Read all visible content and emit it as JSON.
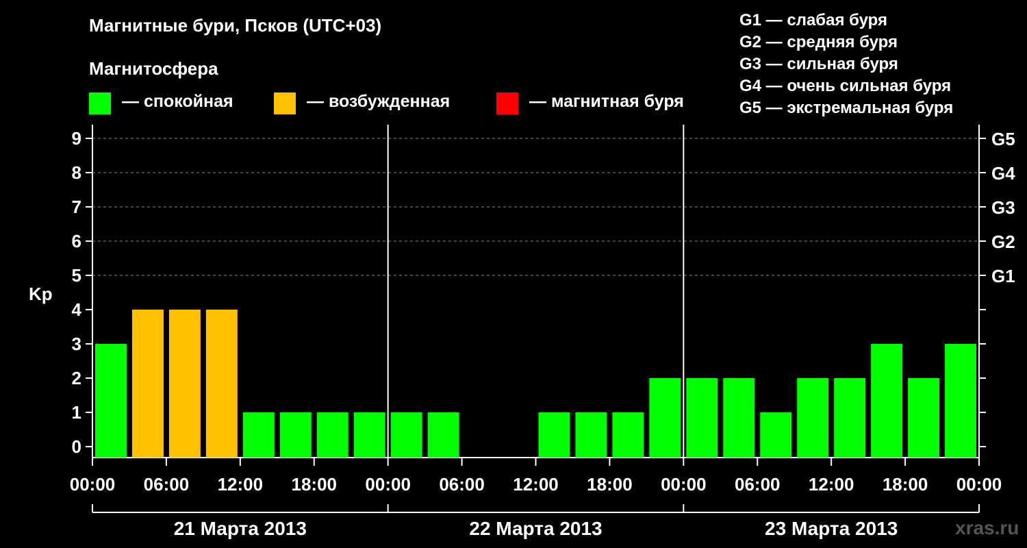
{
  "header": {
    "title": "Магнитные бури, Псков (UTC+03)",
    "magnetosphere_title": "Магнитосфера"
  },
  "legend": {
    "items": [
      {
        "label": "— спокойная",
        "color": "#00ff00"
      },
      {
        "label": "— возбужденная",
        "color": "#ffc000"
      },
      {
        "label": "— магнитная буря",
        "color": "#ff0000"
      }
    ]
  },
  "g_legend": [
    "G1 — слабая буря",
    "G2 — средняя буря",
    "G3 — сильная буря",
    "G4 — очень сильная буря",
    "G5 — экстремальная буря"
  ],
  "site": "xras.ru",
  "chart_data": {
    "type": "bar",
    "ylabel": "Kp",
    "ylim": [
      0,
      9
    ],
    "y_ticks": [
      "0",
      "1",
      "2",
      "3",
      "4",
      "5",
      "6",
      "7",
      "8",
      "9"
    ],
    "right_axis_labels": [
      {
        "value": 5,
        "label": "G1"
      },
      {
        "value": 6,
        "label": "G2"
      },
      {
        "value": 7,
        "label": "G3"
      },
      {
        "value": 8,
        "label": "G4"
      },
      {
        "value": 9,
        "label": "G5"
      }
    ],
    "x_tick_labels": [
      "00:00",
      "06:00",
      "12:00",
      "18:00",
      "00:00",
      "06:00",
      "12:00",
      "18:00",
      "00:00",
      "06:00",
      "12:00",
      "18:00",
      "00:00"
    ],
    "days": [
      "21 Марта 2013",
      "22 Марта 2013",
      "23 Марта 2013"
    ],
    "interval_hours": 3,
    "values": [
      3,
      4,
      4,
      4,
      1,
      1,
      1,
      1,
      1,
      1,
      0,
      0,
      1,
      1,
      1,
      2,
      2,
      2,
      1,
      2,
      2,
      3,
      2,
      3
    ],
    "status": [
      "calm",
      "active",
      "active",
      "active",
      "calm",
      "calm",
      "calm",
      "calm",
      "calm",
      "calm",
      "calm",
      "calm",
      "calm",
      "calm",
      "calm",
      "calm",
      "calm",
      "calm",
      "calm",
      "calm",
      "calm",
      "calm",
      "calm",
      "calm"
    ],
    "colors": {
      "calm": "#00ff00",
      "active": "#ffc000",
      "storm": "#ff0000"
    },
    "grid": "dashed horizontal"
  }
}
